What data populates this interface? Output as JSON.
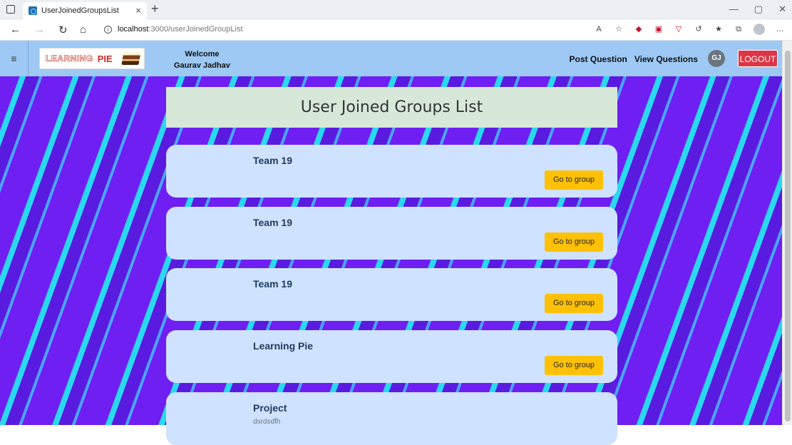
{
  "browser": {
    "tab_title": "UserJoinedGroupsList",
    "tab_close": "×",
    "new_tab": "+",
    "url_host": "localhost",
    "url_path": ":3000/userJoinedGroupList",
    "win_minimize": "—",
    "win_maximize": "▢",
    "win_close": "✕"
  },
  "navbar": {
    "menu_icon": "≡",
    "logo_text_1": "LEARNING",
    "logo_text_2": "PIE",
    "welcome_line": "Welcome",
    "user_name": "Gaurav Jadhav",
    "post_question": "Post Question",
    "view_questions": "View Questions",
    "avatar_initials": "GJ",
    "logout": "LOGOUT"
  },
  "page": {
    "title": "User Joined Groups List",
    "go_label": "Go to group",
    "groups": [
      {
        "name": "Team 19",
        "description": ""
      },
      {
        "name": "Team 19",
        "description": ""
      },
      {
        "name": "Team 19",
        "description": ""
      },
      {
        "name": "Learning Pie",
        "description": ""
      },
      {
        "name": "Project",
        "description": "dsrdsdfh"
      }
    ]
  },
  "colors": {
    "navbar": "#9ec9f5",
    "card": "#cfe2ff",
    "title_card": "#d7e8d8",
    "go_button": "#ffc107",
    "logout": "#dc3545"
  }
}
